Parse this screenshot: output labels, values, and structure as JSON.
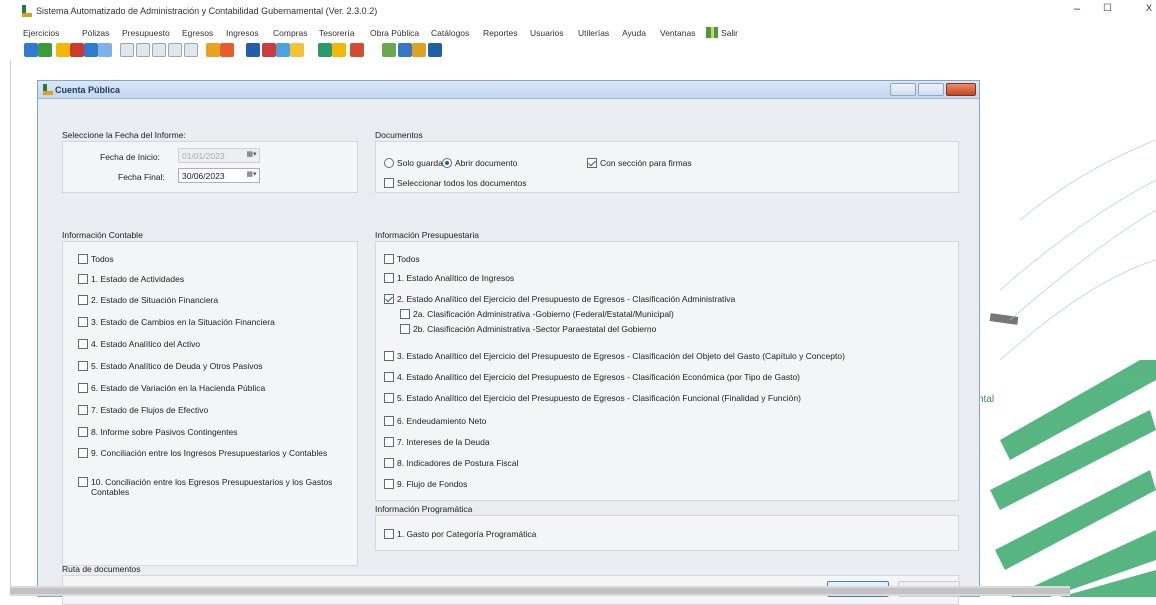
{
  "window": {
    "title": "Sistema Automatizado de Administración y Contabilidad Gubernamental (Ver. 2.3.0.2)",
    "min_symbol": "–",
    "max_symbol": "☐",
    "close_symbol": "X"
  },
  "menu": [
    "Ejercicios",
    "Pólizas",
    "Presupuesto",
    "Egresos",
    "Ingresos",
    "Compras",
    "Tesorería",
    "Obra Pública",
    "Catálogos",
    "Reportes",
    "Usuarios",
    "Utilerías",
    "Ayuda",
    "Ventanas",
    "Salir"
  ],
  "toolbar_colors": [
    "#2f7bd1",
    "#3b9a3b",
    "#f2b705",
    "#cc3b2b",
    "#2f7bd1",
    "#7bb3e8",
    "#e0e6ee",
    "#e0e6ee",
    "#e0e6ee",
    "#e0e6ee",
    "#e0e6ee",
    "#e8a41f",
    "#e85b2b",
    "#1f5fae",
    "#c93d3d",
    "#4aa3e0",
    "#f3c334",
    "#2a9a6a",
    "#f2b705",
    "#d24d2f",
    "#6aa84f",
    "#3576c7",
    "#e0a020",
    "#1e5fa8"
  ],
  "child": {
    "title": "Cuenta Pública",
    "fecha": {
      "section_label": "Seleccione la Fecha del Informe:",
      "inicio_label": "Fecha de Inicio:",
      "inicio_value": "01/01/2023",
      "final_label": "Fecha Final:",
      "final_value": "30/06/2023"
    },
    "documentos": {
      "label": "Documentos",
      "radio_solo": "Solo guardar",
      "radio_abrir": "Abrir documento",
      "cb_firmas": "Con sección para firmas",
      "cb_todos": "Seleccionar todos los documentos"
    },
    "contable": {
      "label": "Información Contable",
      "items": [
        {
          "text": "Todos",
          "checked": false
        },
        {
          "text": "1. Estado de Actividades",
          "checked": false
        },
        {
          "text": "2. Estado de Situación Financiera",
          "checked": false
        },
        {
          "text": "3. Estado de Cambios en la Situación Financiera",
          "checked": false
        },
        {
          "text": "4. Estado Analítico del Activo",
          "checked": false
        },
        {
          "text": "5. Estado Analítico de Deuda y Otros Pasivos",
          "checked": false
        },
        {
          "text": "6. Estado de Variación en la Hacienda Pública",
          "checked": false
        },
        {
          "text": "7. Estado de Flujos de Efectivo",
          "checked": false
        },
        {
          "text": "8. Informe sobre Pasivos Contingentes",
          "checked": false
        },
        {
          "text": "9. Conciliación entre los Ingresos Presupuestarios y Contables",
          "checked": false
        },
        {
          "text": "10. Conciliación entre los Egresos Presupuestarios y los Gastos Contables",
          "checked": false
        }
      ]
    },
    "presupuestaria": {
      "label": "Información Presupuestaria",
      "items": [
        {
          "text": "Todos",
          "checked": false
        },
        {
          "text": "1. Estado Analítico de Ingresos",
          "checked": false
        },
        {
          "text": "2. Estado Analítico del Ejercicio del Presupuesto de Egresos - Clasificación Administrativa",
          "checked": true
        },
        {
          "text": "2a. Clasificación Administrativa -Gobierno (Federal/Estatal/Municipal)",
          "checked": false
        },
        {
          "text": "2b. Clasificación Administrativa -Sector Paraestatal del Gobierno",
          "checked": false
        },
        {
          "text": "3. Estado Analítico del Ejercicio del Presupuesto de Egresos - Clasificación del Objeto del Gasto (Capítulo y Concepto)",
          "checked": false
        },
        {
          "text": "4. Estado Analítico del Ejercicio del Presupuesto de Egresos - Clasificación Económica (por Tipo de Gasto)",
          "checked": false
        },
        {
          "text": "5. Estado Analítico del Ejercicio del Presupuesto de Egresos - Clasificación Funcional (Finalidad y Función)",
          "checked": false
        },
        {
          "text": "6. Endeudamiento Neto",
          "checked": false
        },
        {
          "text": "7. Intereses de la Deuda",
          "checked": false
        },
        {
          "text": "8. Indicadores de Postura Fiscal",
          "checked": false
        },
        {
          "text": "9. Flujo de Fondos",
          "checked": false
        }
      ]
    },
    "programatica": {
      "label": "Información Programática",
      "items": [
        {
          "text": "1. Gasto por Categoría Programática",
          "checked": false
        }
      ]
    },
    "ruta": {
      "label": "Ruta de documentos"
    }
  },
  "background_text": "ntal"
}
